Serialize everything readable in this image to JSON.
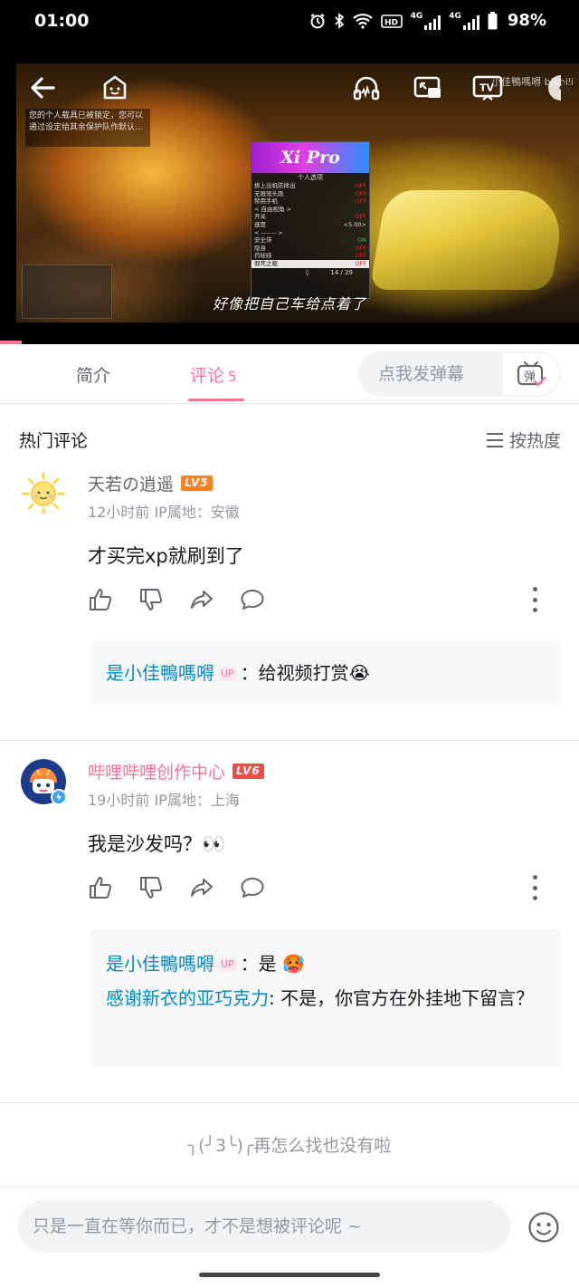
{
  "status_bar": {
    "time": "01:00",
    "battery": "98%",
    "net1": "4G",
    "net2": "4G"
  },
  "video": {
    "notice_text": "您的个人载具已被锁定，您可以通过设定给其余保护队作默认...",
    "subtitle": "好像把自己车给点着了",
    "watermark": "小佳鴨嗎嘚 bilibili",
    "menu": {
      "title": "Xi Pro",
      "subtitle": "个人选项",
      "rows": [
        {
          "label": "摔上出机防摔出",
          "state": "OFF"
        },
        {
          "label": "无限领头跑",
          "state": "OFF"
        },
        {
          "label": "禁用手机",
          "state": "OFF"
        },
        {
          "label": "< 自由视角 >",
          "state": ""
        },
        {
          "label": "开关",
          "state": "OFF"
        },
        {
          "label": "速度",
          "state": "<5.00>"
        },
        {
          "label": "< ------- >",
          "state": ""
        },
        {
          "label": "安全带",
          "state": "ON"
        },
        {
          "label": "隐身",
          "state": "OFF"
        },
        {
          "label": "药娃娃",
          "state": "OFF"
        },
        {
          "label": "假死之躯",
          "state": "OFF"
        }
      ],
      "page": "14 / 29"
    }
  },
  "tabs": {
    "intro": "简介",
    "comments": "评论",
    "comment_count": "5",
    "danmaku_placeholder": "点我发弹幕",
    "danmaku_button": "弹"
  },
  "hot": {
    "title": "热门评论",
    "sort_label": "按热度"
  },
  "comments": [
    {
      "user": "天若の逍遥",
      "level": "LV5",
      "meta": "12小时前  IP属地：安徽",
      "text": "才买完xp就刷到了",
      "replies": [
        {
          "user": "是小佳鴨嗎嘚",
          "tag": "UP",
          "text": "：给视频打赏😭"
        }
      ]
    },
    {
      "user": "哔哩哔哩创作中心",
      "level": "LV6",
      "meta": "19小时前  IP属地：上海",
      "text": "我是沙发吗？👀",
      "replies": [
        {
          "user": "是小佳鴨嗎嘚",
          "tag": "UP",
          "text": "：是 🥵"
        },
        {
          "user": "感谢新衣的亚巧克力",
          "tag": "",
          "text": ": 不是，你官方在外挂地下留言？"
        }
      ]
    }
  ],
  "end_text": "╮(╯3╰)╭再怎么找也没有啦",
  "bottom": {
    "input_placeholder": "只是一直在等你而已，才不是想被评论呢 ~"
  }
}
